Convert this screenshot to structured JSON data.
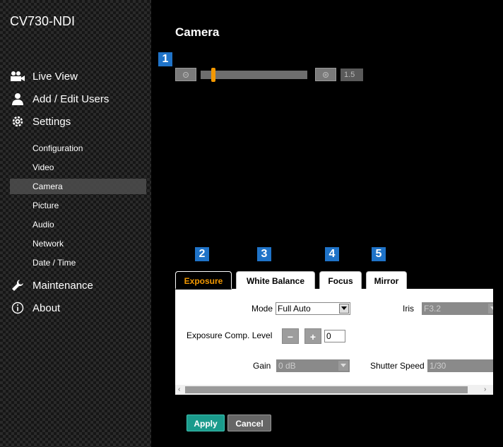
{
  "app": {
    "title": "CV730-NDI"
  },
  "nav": {
    "live_view": "Live View",
    "add_edit_users": "Add / Edit Users",
    "settings": "Settings",
    "sub_items": [
      "Configuration",
      "Video",
      "Camera",
      "Picture",
      "Audio",
      "Network",
      "Date / Time"
    ],
    "active_sub_item": "Camera",
    "maintenance": "Maintenance",
    "about": "About"
  },
  "page": {
    "title": "Camera"
  },
  "badges": [
    "1",
    "2",
    "3",
    "4",
    "5"
  ],
  "zoom": {
    "value": "1.5",
    "position_fraction": 0.1
  },
  "tabs": [
    {
      "label": "Exposure",
      "active": true
    },
    {
      "label": "White Balance",
      "active": false
    },
    {
      "label": "Focus",
      "active": false
    },
    {
      "label": "Mirror",
      "active": false
    }
  ],
  "exposure": {
    "mode_label": "Mode",
    "mode_value": "Full Auto",
    "iris_label": "Iris",
    "iris_value": "F3.2",
    "comp_label": "Exposure Comp. Level",
    "comp_minus": "−",
    "comp_plus": "+",
    "comp_value": "0",
    "gain_label": "Gain",
    "gain_value": "0 dB",
    "shutter_label": "Shutter Speed",
    "shutter_value": "1/30"
  },
  "actions": {
    "apply": "Apply",
    "cancel": "Cancel"
  },
  "colors": {
    "accent": "#f39800",
    "badge": "#1f73c8",
    "apply": "#1a9b8c"
  }
}
